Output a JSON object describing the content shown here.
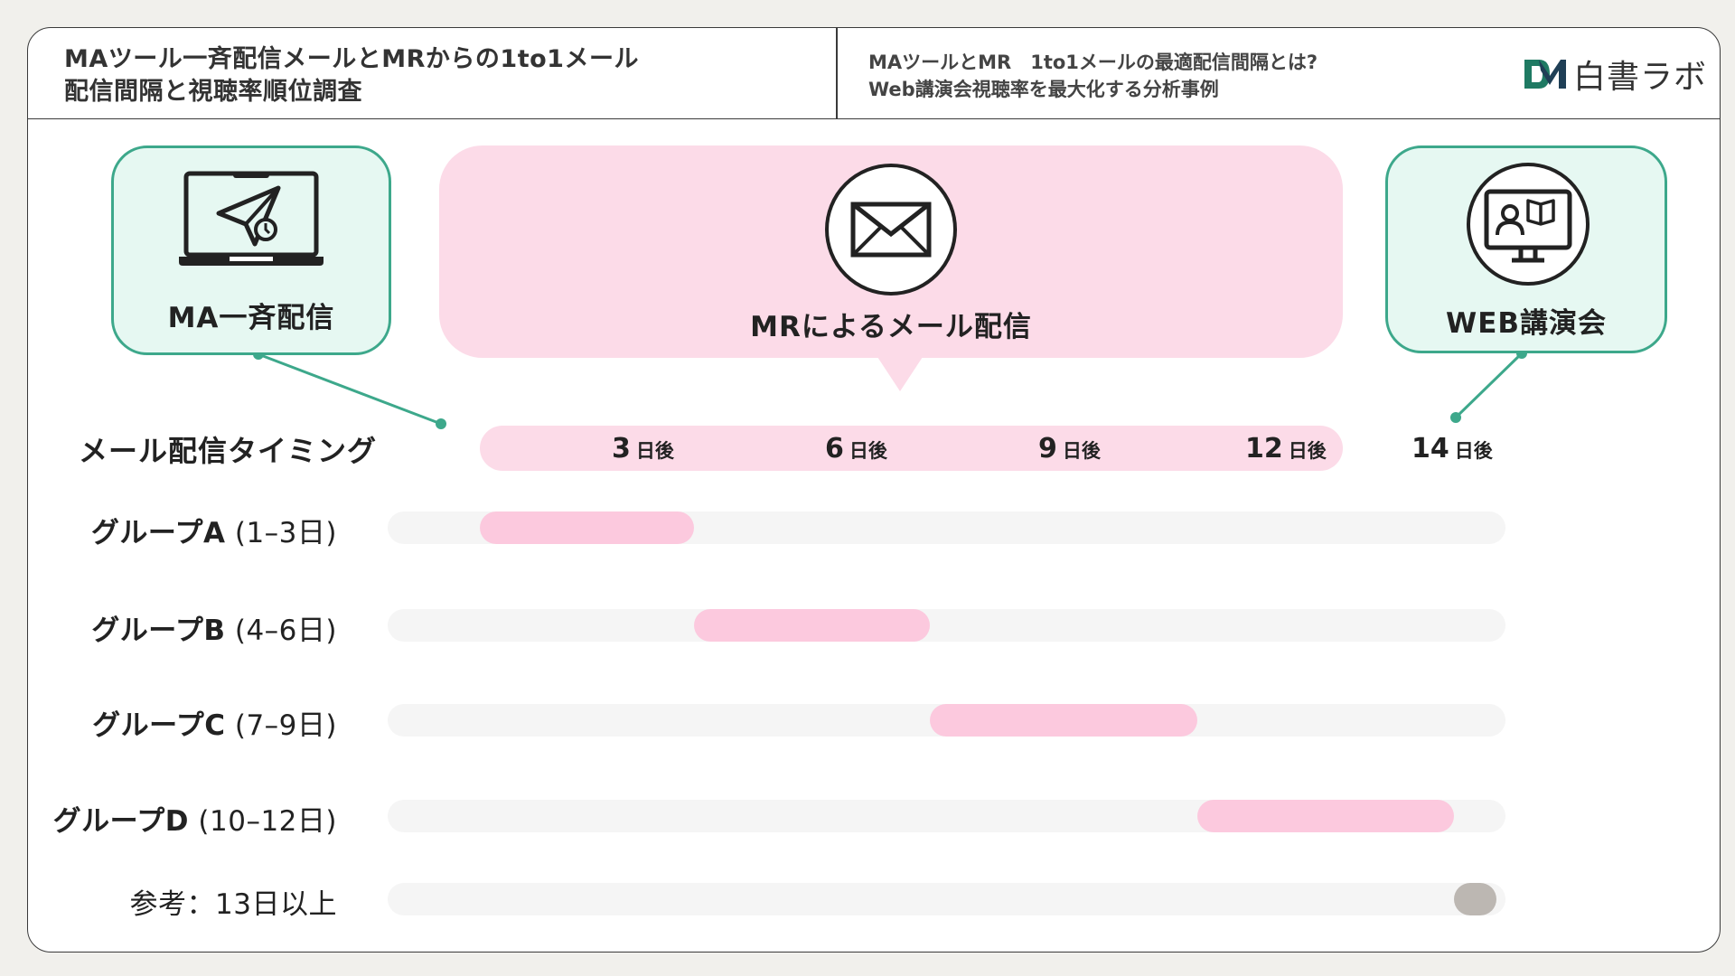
{
  "header": {
    "title_line1": "MAツール一斉配信メールとMRからの1to1メール",
    "title_line2": "配信間隔と視聴率順位調査",
    "subtitle_line1": "MAツールとMR　1to1メールの最適配信間隔とは?",
    "subtitle_line2": "Web講演会視聴率を最大化する分析事例",
    "logo_text": "白書ラボ"
  },
  "boxes": {
    "ma": "MA一斉配信",
    "mr": "MRによるメール配信",
    "web": "WEB講演会"
  },
  "timeline": {
    "label": "メール配信タイミング",
    "ticks": [
      {
        "num": "3",
        "unit": "日後"
      },
      {
        "num": "6",
        "unit": "日後"
      },
      {
        "num": "9",
        "unit": "日後"
      },
      {
        "num": "12",
        "unit": "日後"
      },
      {
        "num": "14",
        "unit": "日後"
      }
    ]
  },
  "rows": [
    {
      "name": "グループA",
      "range": "(1–3日)",
      "start": 0,
      "end": 3
    },
    {
      "name": "グループB",
      "range": "(4–6日)",
      "start": 3,
      "end": 6.3
    },
    {
      "name": "グループC",
      "range": "(7–9日)",
      "start": 6.3,
      "end": 10.05
    },
    {
      "name": "グループD",
      "range": "(10–12日)",
      "start": 10.05,
      "end": 13.65
    },
    {
      "name": "",
      "range": "参考：13日以上",
      "start": 13.65,
      "end": 16.5
    }
  ],
  "colors": {
    "accent_green": "#3da88b",
    "pink": "#fcdbe8",
    "segment_pink": "#fcc9de",
    "reference_gray": "#bcb7b2",
    "track": "#f5f5f5"
  }
}
